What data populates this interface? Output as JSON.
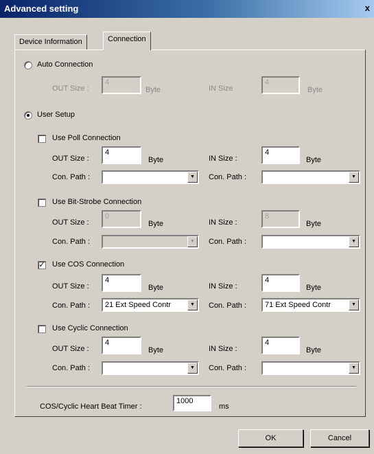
{
  "window": {
    "title": "Advanced setting",
    "close_label": "x"
  },
  "tabs": [
    {
      "label": "Device Information"
    },
    {
      "label": "Connection"
    }
  ],
  "auto": {
    "label": "Auto Connection",
    "out_label": "OUT Size :",
    "out_value": "4",
    "out_unit": "Byte",
    "in_label": "IN Size",
    "in_value": "4",
    "in_unit": "Byte"
  },
  "user_setup": {
    "label": "User Setup"
  },
  "poll": {
    "label": "Use Poll Connection",
    "checked": "",
    "out_label": "OUT Size :",
    "out_value": "4",
    "out_unit": "Byte",
    "in_label": "IN Size :",
    "in_value": "4",
    "in_unit": "Byte",
    "path_label": "Con. Path :",
    "path_out_value": "",
    "path_in_value": ""
  },
  "bitstrobe": {
    "label": "Use Bit-Strobe Connection",
    "checked": "",
    "out_label": "OUT Size :",
    "out_value": "0",
    "out_unit": "Byte",
    "in_label": "IN Size :",
    "in_value": "8",
    "in_unit": "Byte",
    "path_label": "Con. Path :",
    "path_out_value": "",
    "path_in_value": ""
  },
  "cos": {
    "label": "Use COS Connection",
    "checked": "✓",
    "out_label": "OUT Size :",
    "out_value": "4",
    "out_unit": "Byte",
    "in_label": "IN Size :",
    "in_value": "4",
    "in_unit": "Byte",
    "path_label": "Con. Path :",
    "path_out_value": "21 Ext Speed Contr",
    "path_in_value": "71 Ext Speed Contr"
  },
  "cyclic": {
    "label": "Use Cyclic Connection",
    "checked": "",
    "out_label": "OUT Size :",
    "out_value": "4",
    "out_unit": "Byte",
    "in_label": "IN Size :",
    "in_value": "4",
    "in_unit": "Byte",
    "path_label": "Con. Path :",
    "path_out_value": "",
    "path_in_value": ""
  },
  "heartbeat": {
    "label": "COS/Cyclic Heart Beat Timer :",
    "value": "1000",
    "unit": "ms"
  },
  "buttons": {
    "ok": "OK",
    "cancel": "Cancel"
  },
  "icons": {
    "dropdown": "▼",
    "radio": "radio-icon",
    "checkbox": "checkbox-icon"
  },
  "colors": {
    "face": "#d4d0c8",
    "title_start": "#0a246a",
    "title_end": "#a6caf0"
  }
}
